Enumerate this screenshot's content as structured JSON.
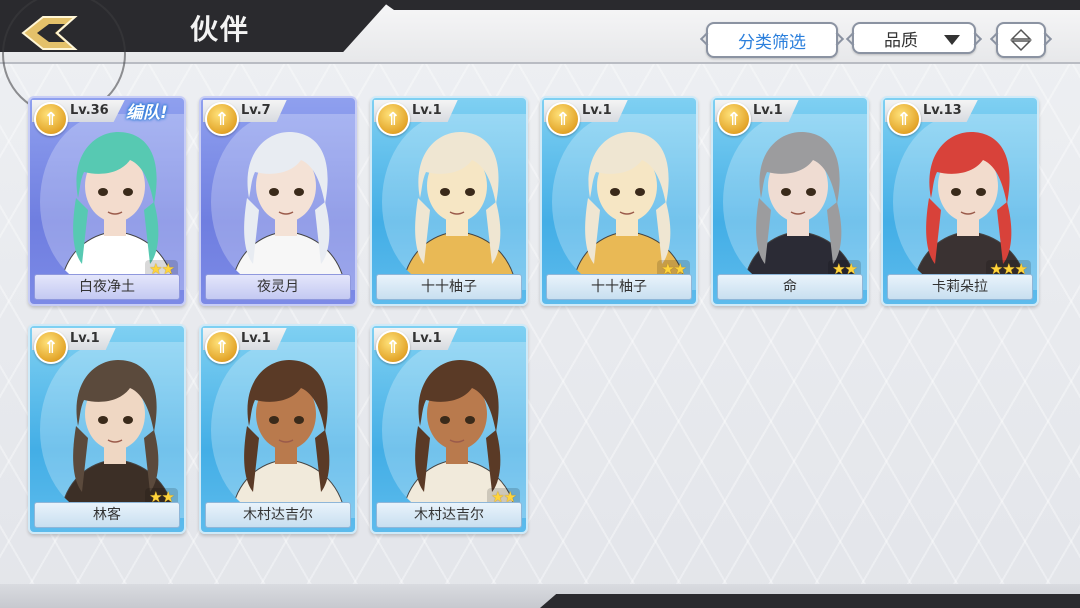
{
  "header": {
    "title": "伙伴",
    "filter_label": "分类筛选",
    "quality_label": "品质"
  },
  "colors": {
    "accent_blue": "#2b7fdc",
    "card_blue": "#43aee6",
    "card_purple": "#6f7ee0",
    "star": "#ffd43b"
  },
  "partners": [
    {
      "name": "白夜净土",
      "level": "Lv.36",
      "tag": "编队!",
      "stars": "★★",
      "frame": "purple",
      "hair": "#57c9b2",
      "skin": "#f3dccd",
      "outfit": "#ffffff"
    },
    {
      "name": "夜灵月",
      "level": "Lv.7",
      "tag": "",
      "stars": "",
      "frame": "purple",
      "hair": "#e8ecf2",
      "skin": "#f4e2d6",
      "outfit": "#f7f7f7"
    },
    {
      "name": "十十柚子",
      "level": "Lv.1",
      "tag": "",
      "stars": "",
      "frame": "blue",
      "hair": "#efe6d2",
      "skin": "#f6e6c4",
      "outfit": "#e9b955"
    },
    {
      "name": "十十柚子",
      "level": "Lv.1",
      "tag": "",
      "stars": "★★",
      "frame": "blue",
      "hair": "#efe6d2",
      "skin": "#f6e6c4",
      "outfit": "#e9b955"
    },
    {
      "name": "命",
      "level": "Lv.1",
      "tag": "",
      "stars": "★★",
      "frame": "blue",
      "hair": "#9c9c9e",
      "skin": "#efdcd2",
      "outfit": "#2b2b35"
    },
    {
      "name": "卡莉朵拉",
      "level": "Lv.13",
      "tag": "",
      "stars": "★★★",
      "frame": "blue",
      "hair": "#d8423a",
      "skin": "#f2dccd",
      "outfit": "#3a3232"
    },
    {
      "name": "林客",
      "level": "Lv.1",
      "tag": "",
      "stars": "★★",
      "frame": "blue",
      "hair": "#5b4a3c",
      "skin": "#efd7c3",
      "outfit": "#3c2f26"
    },
    {
      "name": "木村达吉尔",
      "level": "Lv.1",
      "tag": "",
      "stars": "",
      "frame": "blue",
      "hair": "#5a3a26",
      "skin": "#b97a4d",
      "outfit": "#f1eadb"
    },
    {
      "name": "木村达吉尔",
      "level": "Lv.1",
      "tag": "",
      "stars": "★★",
      "frame": "blue",
      "hair": "#5a3a26",
      "skin": "#b97a4d",
      "outfit": "#f1eadb"
    }
  ]
}
